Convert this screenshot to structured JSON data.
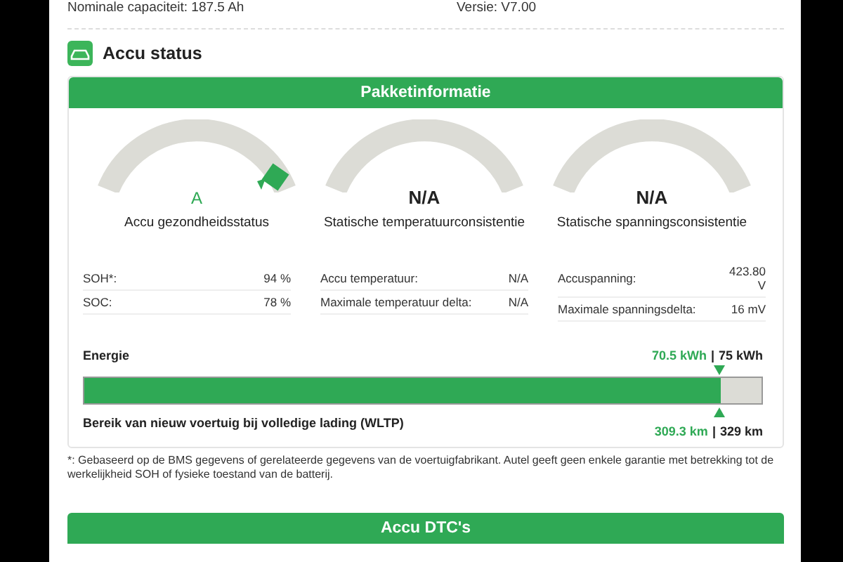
{
  "header": {
    "capacity": "Nominale capaciteit: 187.5 Ah",
    "version": "Versie: V7.00"
  },
  "section": {
    "title": "Accu status"
  },
  "panel": {
    "title": "Pakketinformatie",
    "gauges": [
      {
        "value": "A",
        "label": "Accu gezondheidsstatus",
        "marker": true
      },
      {
        "value": "N/A",
        "label": "Statische temperatuurconsistentie",
        "marker": false
      },
      {
        "value": "N/A",
        "label": "Statische spanningsconsistentie",
        "marker": false
      }
    ],
    "stats": [
      [
        {
          "label": "SOH*:",
          "value": "94 %"
        },
        {
          "label": "SOC:",
          "value": "78 %"
        }
      ],
      [
        {
          "label": "Accu temperatuur:",
          "value": "N/A"
        },
        {
          "label": "Maximale temperatuur delta:",
          "value": "N/A"
        }
      ],
      [
        {
          "label": "Accuspanning:",
          "value": "423.80 V"
        },
        {
          "label": "Maximale spanningsdelta:",
          "value": "16 mV"
        }
      ]
    ],
    "energy": {
      "label": "Energie",
      "current": "70.5 kWh",
      "separator": "|",
      "total": "75 kWh",
      "level": 0.94,
      "range_label": "Bereik van nieuw voertuig bij volledige lading (WLTP)",
      "range_current": "309.3 km",
      "range_separator": "|",
      "range_total": "329 km"
    }
  },
  "footnote": "*: Gebaseerd op de BMS gegevens of gerelateerde gegevens van de voertuigfabrikant. Autel geeft geen enkele garantie met betrekking tot de werkelijkheid SOH of fysieke toestand van de batterij.",
  "dtc": {
    "title": "Accu DTC's"
  }
}
